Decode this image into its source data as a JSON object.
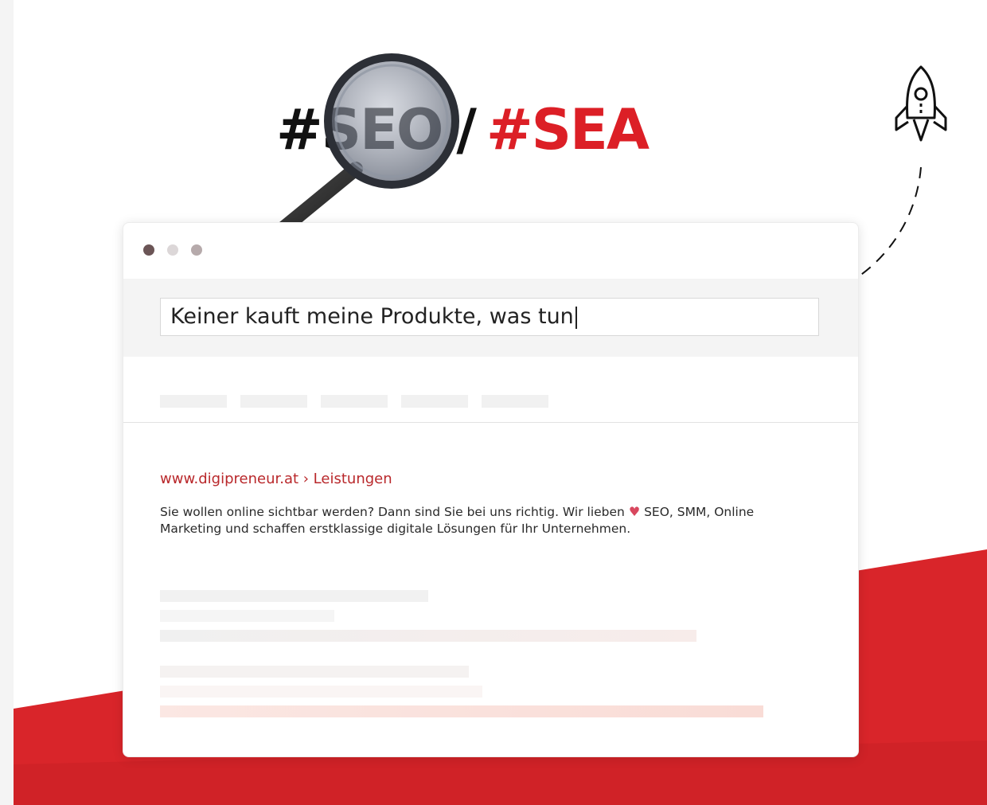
{
  "headline": {
    "seo": "#SEO",
    "slash": "/",
    "sea": "#SEA"
  },
  "colors": {
    "accent_red": "#dc1f26",
    "url_red": "#b9282b",
    "heart": "#d8475e"
  },
  "browser": {
    "window_dots": [
      "dark",
      "light",
      "medium"
    ],
    "search": {
      "value": "Keiner kauft meine Produkte, was tun"
    },
    "result": {
      "url": "www.digipreneur.at › Leistungen",
      "description_before_icon": "Sie wollen online sichtbar werden? Dann sind Sie bei uns richtig. Wir lieben",
      "icon": "heart-icon",
      "description_after_icon": " SEO, SMM, Online Marketing und schaffen erstklassige digitale Lösungen für Ihr Unternehmen."
    }
  },
  "decorations": {
    "magnifier": "magnifier-icon",
    "rocket": "rocket-icon"
  }
}
